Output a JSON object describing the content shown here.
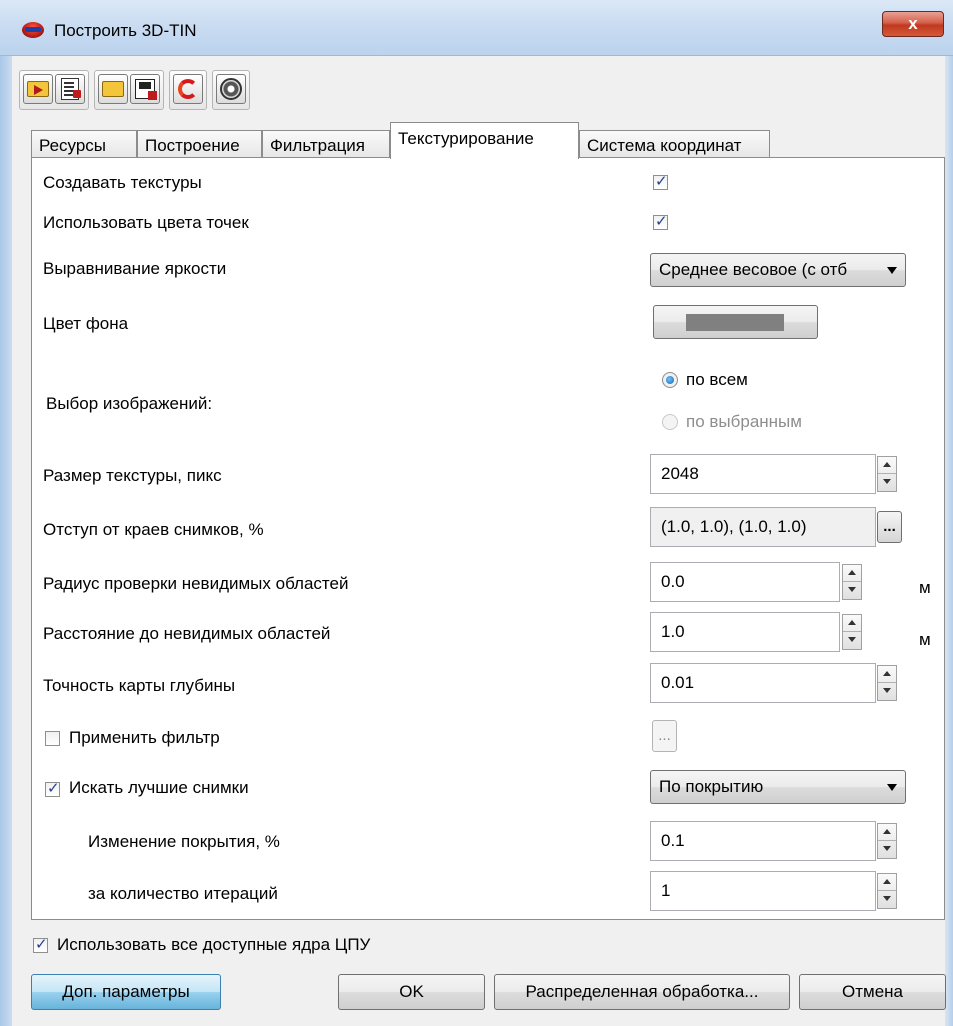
{
  "window": {
    "title": "Построить 3D-TIN",
    "close_label": "x"
  },
  "toolbar": {
    "groups": [
      [
        "folder-open-arrow-icon",
        "document-export-icon"
      ],
      [
        "folder-icon",
        "save-icon"
      ],
      [
        "refresh-icon"
      ],
      [
        "settings-gear-icon"
      ]
    ]
  },
  "tabs": {
    "items": [
      {
        "label": "Ресурсы",
        "active": false
      },
      {
        "label": "Построение",
        "active": false
      },
      {
        "label": "Фильтрация",
        "active": false
      },
      {
        "label": "Текстурирование",
        "active": true
      },
      {
        "label": "Система координат",
        "active": false
      }
    ]
  },
  "texturing": {
    "create_textures": {
      "label": "Создавать текстуры",
      "checked": true
    },
    "use_point_colors": {
      "label": "Использовать цвета точек",
      "checked": true
    },
    "brightness": {
      "label": "Выравнивание яркости",
      "value": "Среднее весовое (с отб"
    },
    "bg_color": {
      "label": "Цвет фона",
      "color": "#808080"
    },
    "image_selection": {
      "label": "Выбор изображений:",
      "option_all": "по всем",
      "option_selected": "по выбранным",
      "selected": "по всем"
    },
    "texture_size": {
      "label": "Размер текстуры, пикс",
      "value": "2048"
    },
    "edge_margin": {
      "label": "Отступ от краев снимков, %",
      "value": "(1.0, 1.0), (1.0, 1.0)",
      "button": "..."
    },
    "invisible_radius": {
      "label": "Радиус проверки невидимых областей",
      "value": "0.0",
      "unit": "м"
    },
    "invisible_distance": {
      "label": "Расстояние до невидимых областей",
      "value": "1.0",
      "unit": "м"
    },
    "depth_accuracy": {
      "label": "Точность карты глубины",
      "value": "0.01"
    },
    "apply_filter": {
      "label": "Применить фильтр",
      "checked": false,
      "button": "..."
    },
    "best_images": {
      "label": "Искать лучшие снимки",
      "checked": true,
      "value": "По покрытию"
    },
    "coverage_change": {
      "label": "Изменение покрытия, %",
      "value": "0.1"
    },
    "iterations": {
      "label": "за количество итераций",
      "value": "1"
    }
  },
  "footer": {
    "use_all_cores": {
      "label": "Использовать все доступные ядра ЦПУ",
      "checked": true
    },
    "advanced_label": "Доп. параметры",
    "ok_label": "OK",
    "distributed_label": "Распределенная обработка...",
    "cancel_label": "Отмена"
  }
}
